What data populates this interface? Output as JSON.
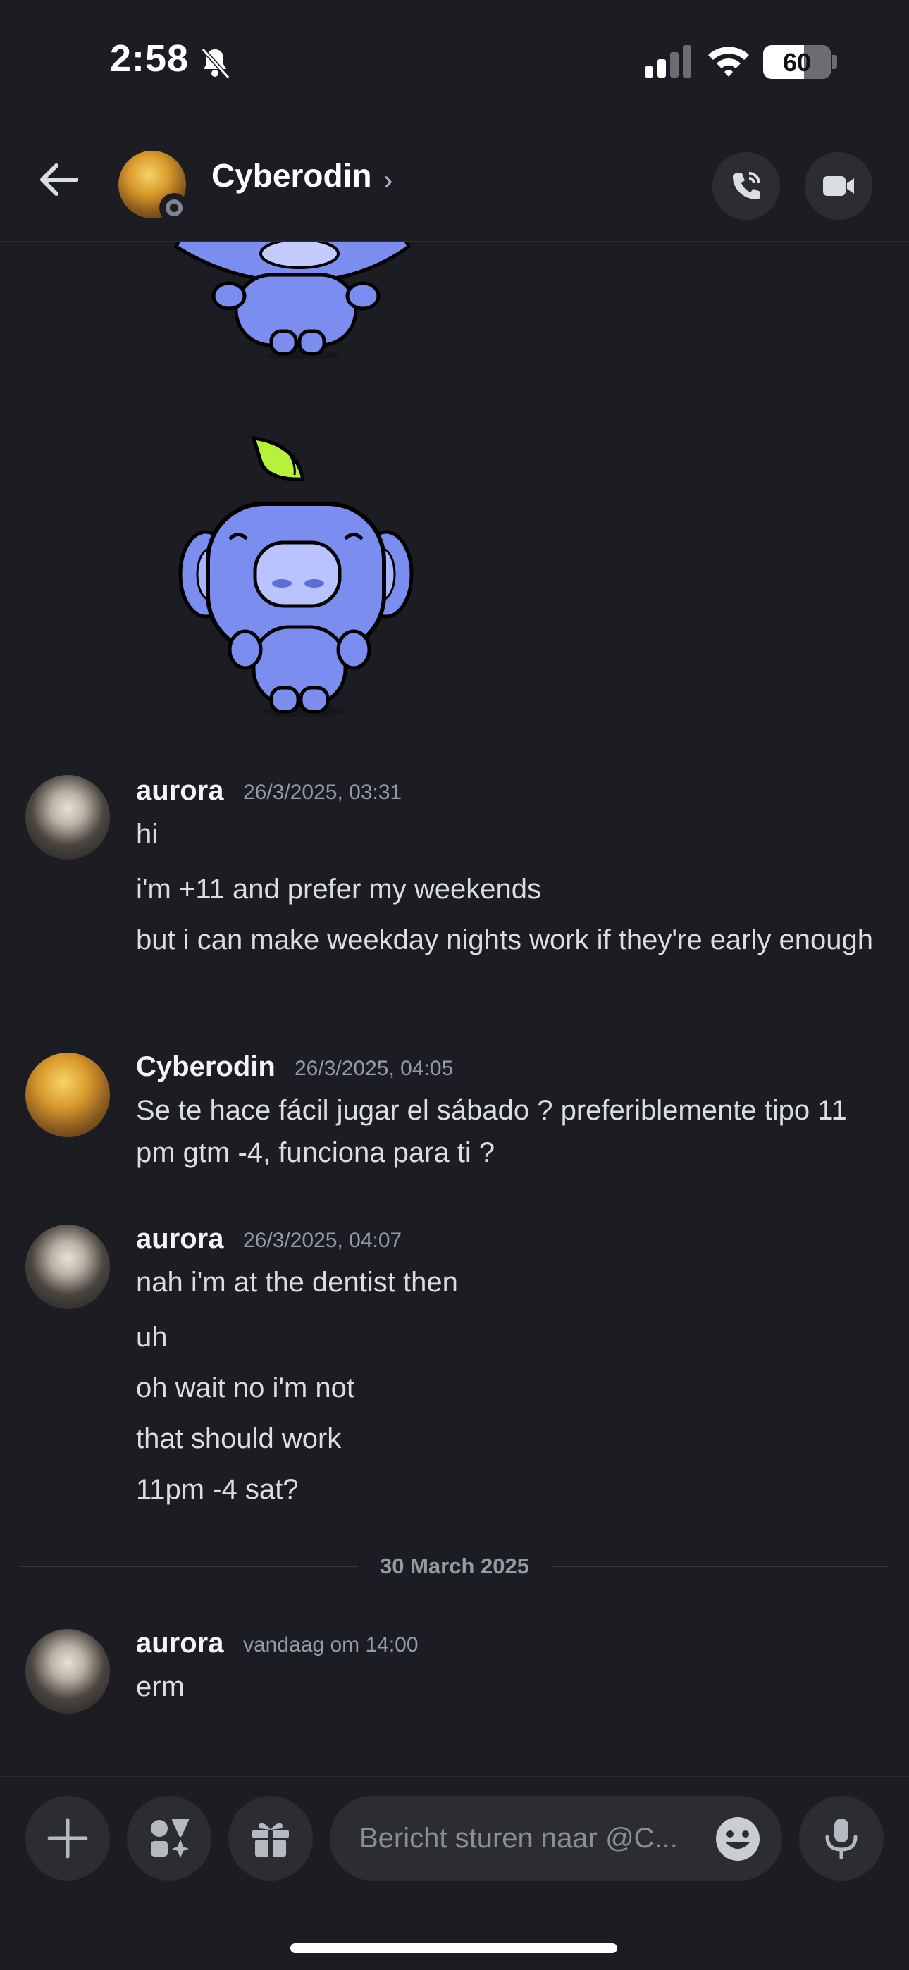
{
  "status_bar": {
    "time": "2:58",
    "battery": "60",
    "battery_level": 0.6
  },
  "header": {
    "name": "Cyberodin",
    "chevron": "›"
  },
  "messages": [
    {
      "username": "aurora",
      "timestamp": "26/3/2025, 03:31",
      "lines": [
        "hi",
        "i'm +11 and prefer my weekends",
        "but i can make weekday nights work if they're early enough"
      ]
    },
    {
      "username": "Cyberodin",
      "timestamp": "26/3/2025, 04:05",
      "lines": [
        "Se te hace fácil jugar el sábado ? preferiblemente tipo 11 pm gtm -4, funciona para ti ?"
      ]
    },
    {
      "username": "aurora",
      "timestamp": "26/3/2025, 04:07",
      "lines": [
        "nah i'm at the dentist then",
        "uh",
        "oh wait no i'm not",
        "that should work",
        "11pm -4 sat?"
      ]
    },
    {
      "username": "aurora",
      "timestamp": "vandaag om 14:00",
      "lines": [
        "erm"
      ]
    }
  ],
  "date_divider": "30 March 2025",
  "composer": {
    "placeholder": "Bericht sturen naar @C..."
  },
  "icons": [
    "bell-off-icon",
    "signal-icon",
    "wifi-icon",
    "battery-icon",
    "back-arrow-icon",
    "phone-call-icon",
    "video-camera-icon",
    "plus-icon",
    "apps-icon",
    "gift-icon",
    "emoji-icon",
    "microphone-icon"
  ],
  "colors": {
    "background": "#1c1d22",
    "surface": "#2b2d31",
    "text": "#dbdee1",
    "muted": "#949ba4",
    "sticker_blue": "#7b8ef0",
    "sprout_green": "#b6f23c"
  }
}
